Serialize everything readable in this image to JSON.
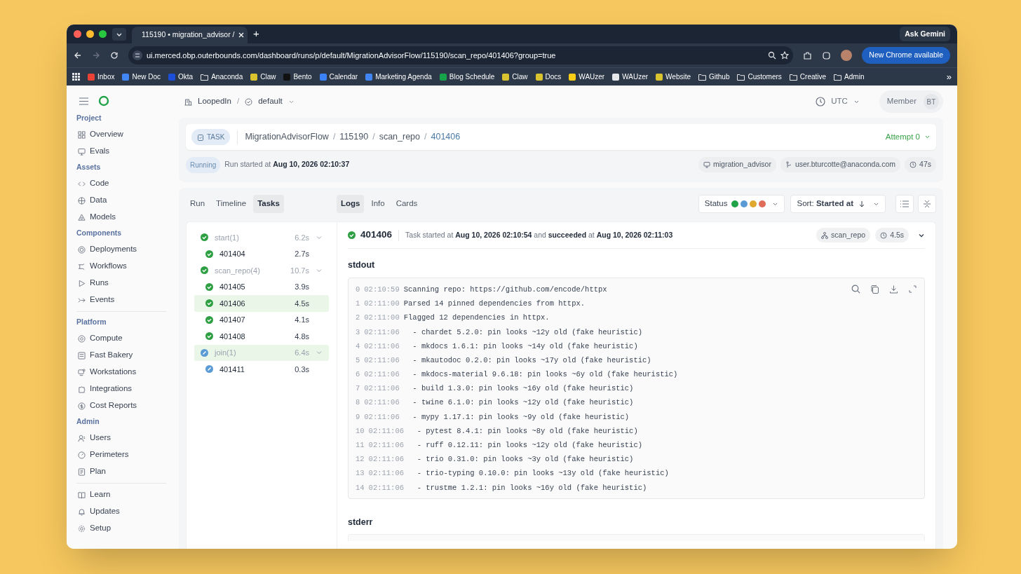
{
  "browser": {
    "tab_title": "115190 • migration_advisor /",
    "new_tab": "+",
    "ask_button": "Ask Gemini",
    "url": "ui.merced.obp.outerbounds.com/dashboard/runs/p/default/MigrationAdvisorFlow/115190/scan_repo/401406?group=true",
    "update_button": "New Chrome available",
    "more": "»"
  },
  "bookmarks": [
    {
      "label": "Inbox",
      "kind": "site",
      "color": "#ea4335"
    },
    {
      "label": "New Doc",
      "kind": "site",
      "color": "#4285f4"
    },
    {
      "label": "Okta",
      "kind": "site",
      "color": "#1d4ed8"
    },
    {
      "label": "Anaconda",
      "kind": "folder"
    },
    {
      "label": "Claw",
      "kind": "site",
      "color": "#d9c430"
    },
    {
      "label": "Bento",
      "kind": "site",
      "color": "#111111"
    },
    {
      "label": "Calendar",
      "kind": "site",
      "color": "#3b82f6"
    },
    {
      "label": "Marketing Agenda",
      "kind": "site",
      "color": "#4285f4"
    },
    {
      "label": "Blog Schedule",
      "kind": "site",
      "color": "#16a34a"
    },
    {
      "label": "Claw",
      "kind": "site",
      "color": "#d9c430"
    },
    {
      "label": "Docs",
      "kind": "site",
      "color": "#d9c430"
    },
    {
      "label": "WAUzer",
      "kind": "site",
      "color": "#facc15"
    },
    {
      "label": "WAUzer",
      "kind": "site",
      "color": "#e5e7eb"
    },
    {
      "label": "Website",
      "kind": "site",
      "color": "#d9c430"
    },
    {
      "label": "Github",
      "kind": "folder"
    },
    {
      "label": "Customers",
      "kind": "folder"
    },
    {
      "label": "Creative",
      "kind": "folder"
    },
    {
      "label": "Admin",
      "kind": "folder"
    }
  ],
  "topbar": {
    "separator": "/",
    "project": "LoopedIn",
    "branch": "default",
    "timezone": "UTC",
    "role": "Member",
    "initials": "BT"
  },
  "sidebar": [
    {
      "heading": "Project",
      "items": [
        "Overview",
        "Evals"
      ]
    },
    {
      "heading": "Assets",
      "items": [
        "Code",
        "Data",
        "Models"
      ]
    },
    {
      "heading": "Components",
      "items": [
        "Deployments",
        "Workflows",
        "Runs",
        "Events"
      ]
    },
    {
      "heading": "Platform",
      "items": [
        "Compute",
        "Fast Bakery",
        "Workstations",
        "Integrations",
        "Cost Reports"
      ]
    },
    {
      "heading": "Admin",
      "items": [
        "Users",
        "Perimeters",
        "Plan"
      ]
    },
    {
      "items": [
        "Learn",
        "Updates",
        "Setup"
      ]
    }
  ],
  "task_header": {
    "separator": "/",
    "badge": "TASK",
    "breadcrumb": [
      "MigrationAdvisorFlow",
      "115190",
      "scan_repo",
      "401406"
    ],
    "attempt": "Attempt 0"
  },
  "run_status": {
    "badge": "Running",
    "text": "Run started at **Aug 10, 2026 02:10:37**",
    "chips": [
      "migration_advisor",
      "user.bturcotte@anaconda.com",
      "47s"
    ]
  },
  "view_tabs": [
    {
      "label": "Run",
      "selected": false
    },
    {
      "label": "Timeline",
      "selected": false
    },
    {
      "label": "Tasks",
      "selected": true
    }
  ],
  "detail_tabs": [
    {
      "label": "Logs",
      "selected": true
    },
    {
      "label": "Info",
      "selected": false
    },
    {
      "label": "Cards",
      "selected": false
    }
  ],
  "status_filter": {
    "label": "Status",
    "dots": [
      {
        "color": "#22a34a"
      },
      {
        "color": "#5b9bd5"
      },
      {
        "color": "#e0a82e"
      },
      {
        "color": "#e06c5a"
      }
    ]
  },
  "sort": {
    "label": "Sort:",
    "value": "Started at"
  },
  "tasks": [
    {
      "name": "start(1)",
      "duration": "6.2s",
      "done": true,
      "expanded": true,
      "highlighted": false,
      "children": [
        {
          "name": "401404",
          "duration": "2.7s",
          "done": true,
          "highlighted": false
        }
      ]
    },
    {
      "name": "scan_repo(4)",
      "duration": "10.7s",
      "done": true,
      "expanded": true,
      "highlighted": false,
      "children": [
        {
          "name": "401405",
          "duration": "3.9s",
          "done": true,
          "highlighted": false
        },
        {
          "name": "401406",
          "duration": "4.5s",
          "done": true,
          "highlighted": true
        },
        {
          "name": "401407",
          "duration": "4.1s",
          "done": true,
          "highlighted": false
        },
        {
          "name": "401408",
          "duration": "4.8s",
          "done": true,
          "highlighted": false
        }
      ]
    },
    {
      "name": "join(1)",
      "duration": "6.4s",
      "done": false,
      "expanded": true,
      "highlighted": true,
      "children": [
        {
          "name": "401411",
          "duration": "0.3s",
          "done": false,
          "highlighted": false
        }
      ]
    }
  ],
  "task_detail": {
    "id": "401406",
    "done": true,
    "summary": "Task started at **Aug 10, 2026 02:10:54** and **succeeded** at **Aug 10, 2026 02:11:03**",
    "step": "scan_repo",
    "duration": "4.5s"
  },
  "stdout": {
    "title": "stdout",
    "lines": [
      {
        "number": "0",
        "time": "02:10:59",
        "text": "Scanning repo: https://github.com/encode/httpx"
      },
      {
        "number": "1",
        "time": "02:11:00",
        "text": "Parsed 14 pinned dependencies from httpx."
      },
      {
        "number": "2",
        "time": "02:11:00",
        "text": "Flagged 12 dependencies in httpx."
      },
      {
        "number": "3",
        "time": "02:11:06",
        "text": "  - chardet 5.2.0: pin looks ~12y old (fake heuristic)"
      },
      {
        "number": "4",
        "time": "02:11:06",
        "text": "  - mkdocs 1.6.1: pin looks ~14y old (fake heuristic)"
      },
      {
        "number": "5",
        "time": "02:11:06",
        "text": "  - mkautodoc 0.2.0: pin looks ~17y old (fake heuristic)"
      },
      {
        "number": "6",
        "time": "02:11:06",
        "text": "  - mkdocs-material 9.6.18: pin looks ~6y old (fake heuristic)"
      },
      {
        "number": "7",
        "time": "02:11:06",
        "text": "  - build 1.3.0: pin looks ~16y old (fake heuristic)"
      },
      {
        "number": "8",
        "time": "02:11:06",
        "text": "  - twine 6.1.0: pin looks ~12y old (fake heuristic)"
      },
      {
        "number": "9",
        "time": "02:11:06",
        "text": "  - mypy 1.17.1: pin looks ~9y old (fake heuristic)"
      },
      {
        "number": "10",
        "time": "02:11:06",
        "text": "  - pytest 8.4.1: pin looks ~8y old (fake heuristic)"
      },
      {
        "number": "11",
        "time": "02:11:06",
        "text": "  - ruff 0.12.11: pin looks ~12y old (fake heuristic)"
      },
      {
        "number": "12",
        "time": "02:11:06",
        "text": "  - trio 0.31.0: pin looks ~3y old (fake heuristic)"
      },
      {
        "number": "13",
        "time": "02:11:06",
        "text": "  - trio-typing 0.10.0: pin looks ~13y old (fake heuristic)"
      },
      {
        "number": "14",
        "time": "02:11:06",
        "text": "  - trustme 1.2.1: pin looks ~16y old (fake heuristic)"
      }
    ]
  },
  "stderr": {
    "title": "stderr"
  }
}
